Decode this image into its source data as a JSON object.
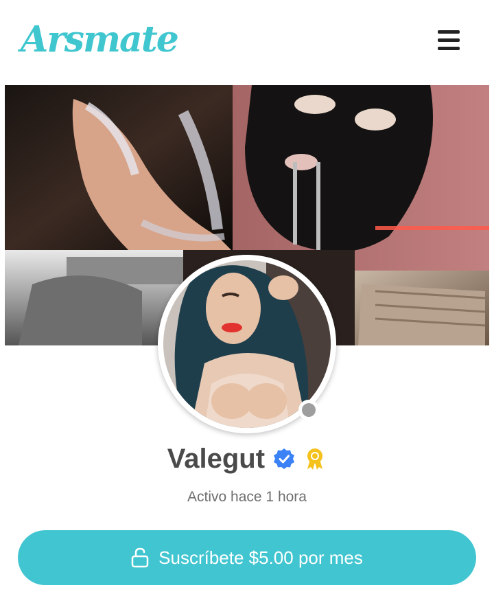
{
  "header": {
    "logo_text": "Arsmate",
    "menu_icon": "hamburger-icon"
  },
  "colors": {
    "brand": "#3fc6cf",
    "button": "#41c5d0",
    "verified": "#3b82f6",
    "award": "#f4c21b",
    "status_offline": "#9e9e9e",
    "name_text": "#4a4a4a"
  },
  "profile": {
    "name": "Valegut",
    "verified_icon": "verified-badge-icon",
    "award_icon": "award-ribbon-icon",
    "last_active": "Activo hace 1 hora"
  },
  "subscribe": {
    "label": "Suscríbete $5.00 por mes",
    "icon": "unlock-icon"
  }
}
